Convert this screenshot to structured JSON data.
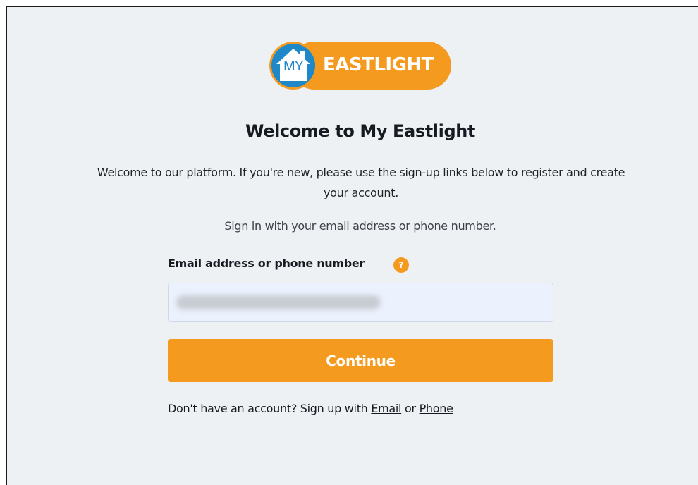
{
  "logo": {
    "badge_text": "MY",
    "brand_text": "EASTLIGHT",
    "colors": {
      "orange": "#f49b1f",
      "blue": "#1e88c9"
    }
  },
  "page": {
    "title": "Welcome to My Eastlight",
    "intro": "Welcome to our platform. If you're new, please use the sign-up links below to register and create your account.",
    "signin_hint": "Sign in with your email address or phone number."
  },
  "form": {
    "email_label": "Email address or phone number",
    "help_icon": "question-mark-icon",
    "help_glyph": "?",
    "email_value": "",
    "continue_label": "Continue"
  },
  "signup": {
    "prefix": "Don't have an account? Sign up with ",
    "email_link": "Email",
    "separator": " or ",
    "phone_link": "Phone"
  }
}
